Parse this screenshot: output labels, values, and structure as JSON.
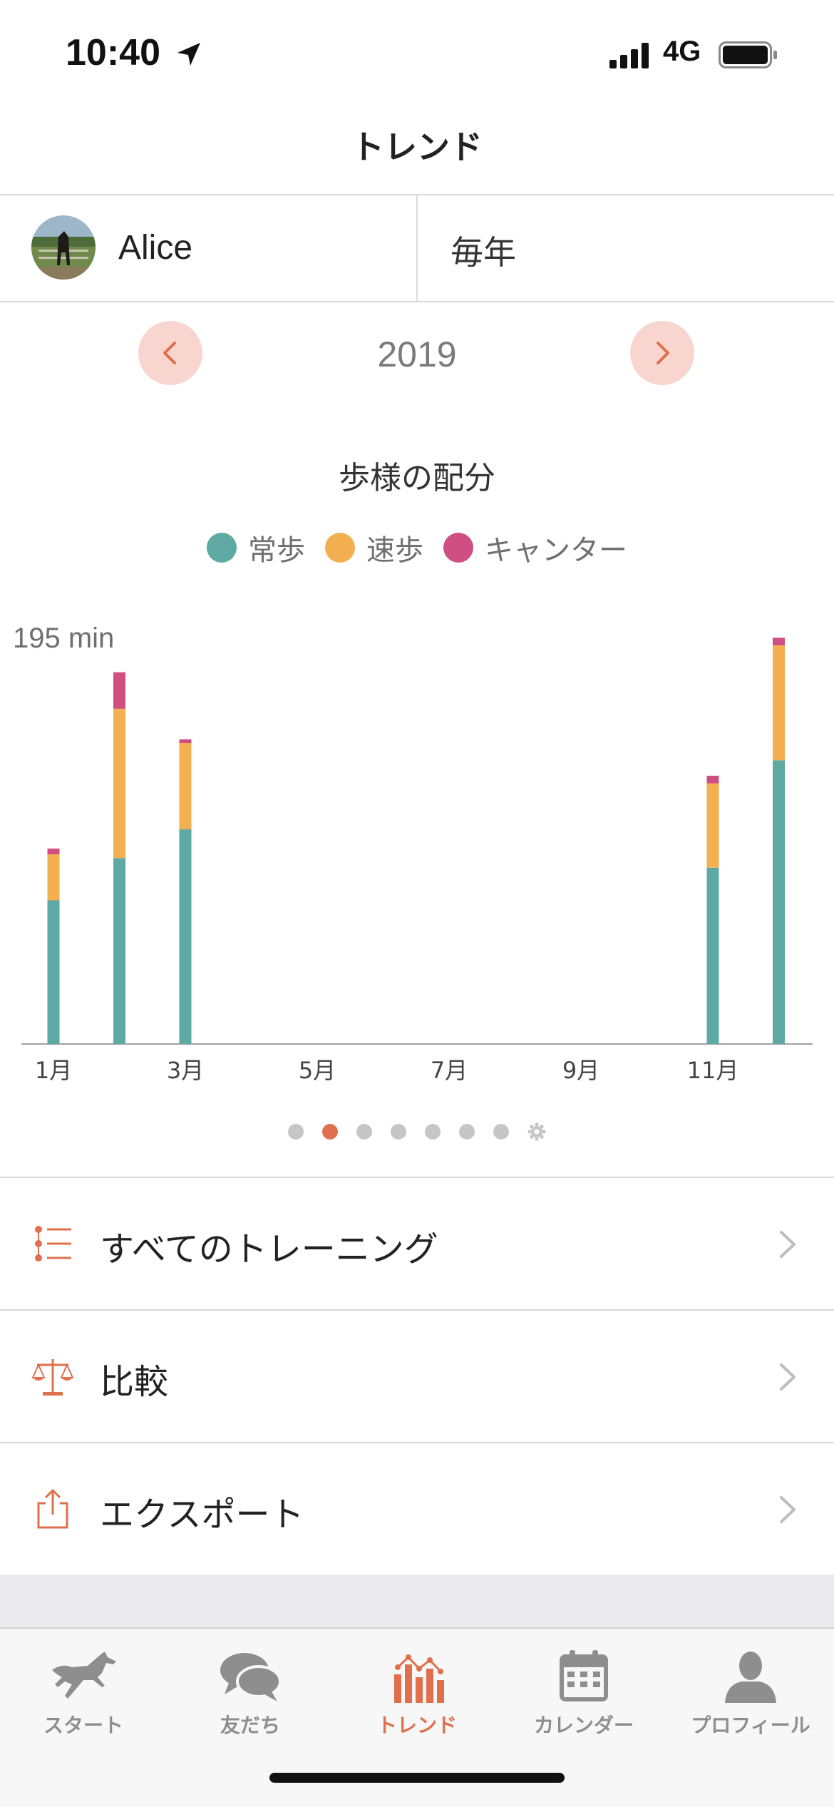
{
  "status_bar": {
    "time": "10:40",
    "network": "4G"
  },
  "nav": {
    "title": "トレンド"
  },
  "selector": {
    "horse_name": "Alice",
    "period": "毎年"
  },
  "year_nav": {
    "year": "2019"
  },
  "colors": {
    "accent": "#e0704d",
    "walk": "#5ea9a4",
    "trot": "#f3b050",
    "canter": "#d04f82"
  },
  "chart": {
    "title": "歩様の配分",
    "y_max_label": "195 min"
  },
  "chart_data": {
    "type": "bar",
    "stacked": true,
    "title": "歩様の配分",
    "ylabel": "195 min",
    "categories": [
      "1月",
      "2月",
      "3月",
      "4月",
      "5月",
      "6月",
      "7月",
      "8月",
      "9月",
      "10月",
      "11月",
      "12月"
    ],
    "x_tick_labels": [
      "1月",
      "3月",
      "5月",
      "7月",
      "9月",
      "11月"
    ],
    "series": [
      {
        "name": "常歩",
        "color": "#5ea9a4",
        "values": [
          75,
          97,
          112,
          0,
          0,
          0,
          0,
          0,
          0,
          0,
          92,
          148
        ]
      },
      {
        "name": "速歩",
        "color": "#f3b050",
        "values": [
          24,
          78,
          45,
          0,
          0,
          0,
          0,
          0,
          0,
          0,
          44,
          60
        ]
      },
      {
        "name": "キャンター",
        "color": "#d04f82",
        "values": [
          3,
          19,
          2,
          0,
          0,
          0,
          0,
          0,
          0,
          0,
          4,
          4
        ]
      }
    ],
    "ylim": [
      0,
      195
    ],
    "legend_position": "top-center",
    "grid": false
  },
  "pager": {
    "count": 7,
    "active_index": 1
  },
  "list": [
    {
      "label": "すべてのトレーニング",
      "icon": "list-icon"
    },
    {
      "label": "比較",
      "icon": "scale-icon"
    },
    {
      "label": "エクスポート",
      "icon": "share-icon"
    }
  ],
  "tabs": [
    {
      "label": "スタート",
      "icon": "horse-icon",
      "active": false
    },
    {
      "label": "友だち",
      "icon": "chat-bubbles-icon",
      "active": false
    },
    {
      "label": "トレンド",
      "icon": "bar-chart-icon",
      "active": true
    },
    {
      "label": "カレンダー",
      "icon": "calendar-icon",
      "active": false
    },
    {
      "label": "プロフィール",
      "icon": "person-icon",
      "active": false
    }
  ]
}
